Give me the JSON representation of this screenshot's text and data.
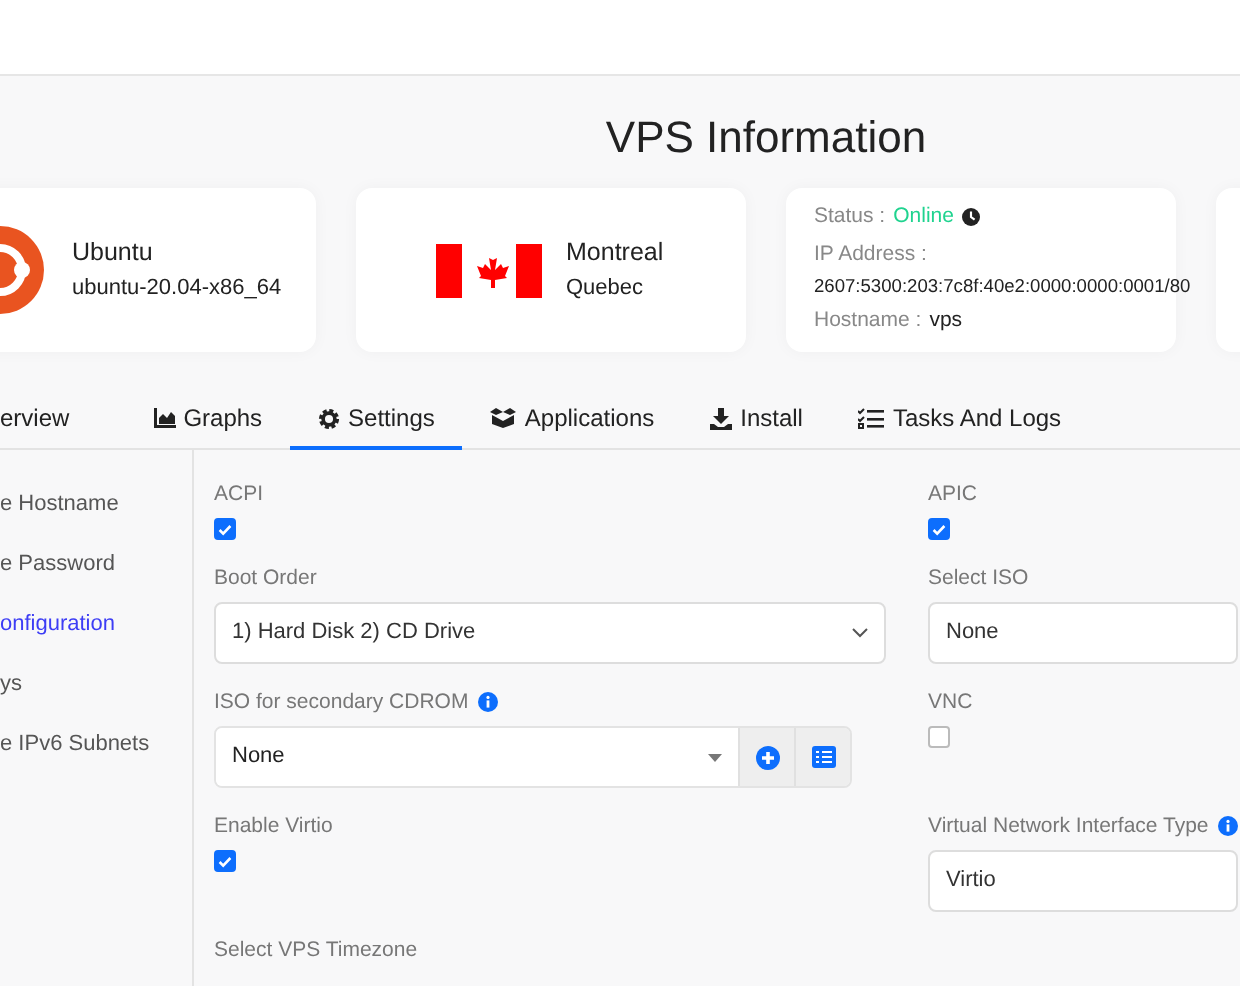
{
  "page_title": "VPS Information",
  "cards": [
    {
      "kind": "os",
      "title": "Ubuntu",
      "subtitle": "ubuntu-20.04-x86_64"
    },
    {
      "kind": "location",
      "title": "Montreal",
      "subtitle": "Quebec"
    },
    {
      "kind": "status",
      "status_label": "Status :",
      "status": "Online",
      "ip_label": "IP Address :",
      "ip": "2607:5300:203:7c8f:40e2:0000:0000:0001/80",
      "hostname_label": "Hostname :",
      "hostname": "vps"
    },
    {
      "kind": "blank"
    }
  ],
  "tabs": [
    {
      "label": "erview",
      "selected": false
    },
    {
      "label": "Graphs",
      "selected": false
    },
    {
      "label": "Settings",
      "selected": true
    },
    {
      "label": "Applications",
      "selected": false
    },
    {
      "label": "Install",
      "selected": false
    },
    {
      "label": "Tasks And Logs",
      "selected": false
    }
  ],
  "sidebar": [
    {
      "label": "e Hostname",
      "selected": false
    },
    {
      "label": "e Password",
      "selected": false
    },
    {
      "label": "onfiguration",
      "selected": true
    },
    {
      "label": "ys",
      "selected": false
    },
    {
      "label": "e IPv6 Subnets",
      "selected": false
    }
  ],
  "left_fields": [
    {
      "kind": "checkbox",
      "label": "ACPI",
      "checked": true
    },
    {
      "kind": "select",
      "label": "Boot Order",
      "value": "1) Hard Disk 2) CD Drive"
    },
    {
      "kind": "combo",
      "label": "ISO for secondary CDROM",
      "info": true,
      "value": "None"
    },
    {
      "kind": "checkbox",
      "label": "Enable Virtio",
      "checked": true
    },
    {
      "kind": "heading",
      "label": "Select VPS Timezone"
    }
  ],
  "right_fields": [
    {
      "kind": "checkbox",
      "label": "APIC",
      "checked": true
    },
    {
      "kind": "select",
      "label": "Select ISO",
      "value": "None"
    },
    {
      "kind": "checkbox",
      "label": "VNC",
      "checked": false
    },
    {
      "kind": "select",
      "label": "Virtual Network Interface Type",
      "info": true,
      "value": "Virtio"
    }
  ]
}
